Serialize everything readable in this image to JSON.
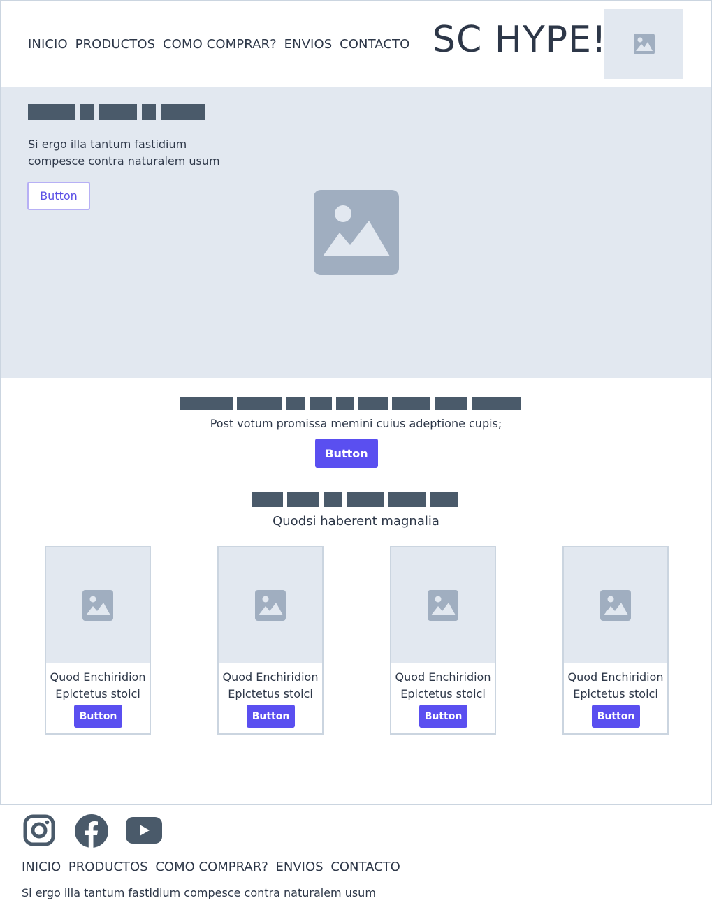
{
  "header": {
    "nav": [
      "INICIO",
      "PRODUCTOS",
      "COMO COMPRAR?",
      "ENVIOS",
      "CONTACTO"
    ],
    "brand": "SC HYPE!",
    "logo_icon": "image-placeholder-icon"
  },
  "hero": {
    "text": "Si ergo illa tantum fastidium compesce contra naturalem usum",
    "button_label": "Button",
    "image_icon": "image-placeholder-icon"
  },
  "cta": {
    "text": "Post votum promissa memini cuius adeptione cupis;",
    "button_label": "Button"
  },
  "products": {
    "subtitle": "Quodsi haberent magnalia",
    "cards": [
      {
        "line1": "Quod Enchiridion",
        "line2": "Epictetus stoici",
        "button_label": "Button"
      },
      {
        "line1": "Quod Enchiridion",
        "line2": "Epictetus stoici",
        "button_label": "Button"
      },
      {
        "line1": "Quod Enchiridion",
        "line2": "Epictetus stoici",
        "button_label": "Button"
      },
      {
        "line1": "Quod Enchiridion",
        "line2": "Epictetus stoici",
        "button_label": "Button"
      }
    ]
  },
  "footer": {
    "social_icons": [
      "instagram-icon",
      "facebook-icon",
      "youtube-icon"
    ],
    "nav": [
      "INICIO",
      "PRODUCTOS",
      "COMO COMPRAR?",
      "ENVIOS",
      "CONTACTO"
    ],
    "text": "Si ergo illa tantum fastidium compesce contra naturalem usum"
  },
  "colors": {
    "primary": "#5a4ff0",
    "placeholder_bg": "#e2e8f0",
    "heading_block": "#4a5a6a",
    "text": "#2d3748"
  }
}
